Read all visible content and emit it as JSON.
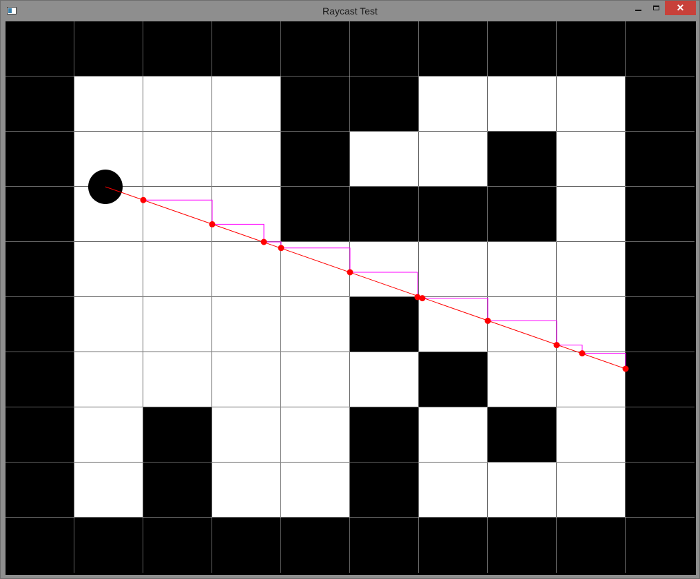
{
  "window": {
    "title": "Raycast Test",
    "minimize_icon": "minimize-icon",
    "maximize_icon": "maximize-icon",
    "close_icon": "close-icon",
    "close_glyph": "✕"
  },
  "grid": {
    "cols": 10,
    "rows": 10,
    "cells": [
      [
        1,
        1,
        1,
        1,
        1,
        1,
        1,
        1,
        1,
        1
      ],
      [
        1,
        0,
        0,
        0,
        1,
        1,
        0,
        0,
        0,
        1
      ],
      [
        1,
        0,
        0,
        0,
        1,
        0,
        0,
        1,
        0,
        1
      ],
      [
        1,
        0,
        0,
        0,
        1,
        1,
        1,
        1,
        0,
        1
      ],
      [
        1,
        0,
        0,
        0,
        0,
        0,
        0,
        0,
        0,
        1
      ],
      [
        1,
        0,
        0,
        0,
        0,
        1,
        0,
        0,
        0,
        1
      ],
      [
        1,
        0,
        0,
        0,
        0,
        0,
        1,
        0,
        0,
        1
      ],
      [
        1,
        0,
        1,
        0,
        0,
        1,
        0,
        1,
        0,
        1
      ],
      [
        1,
        0,
        1,
        0,
        0,
        1,
        0,
        0,
        0,
        1
      ],
      [
        1,
        1,
        1,
        1,
        1,
        1,
        1,
        1,
        1,
        1
      ]
    ],
    "wall_color": "#000000",
    "floor_color": "#ffffff"
  },
  "player": {
    "col": 1.45,
    "row": 3.0,
    "color": "#000000"
  },
  "ray": {
    "color": "#ff0000",
    "step_color": "#ff00ff",
    "hits": [
      [
        2.0,
        3.24
      ],
      [
        3.0,
        3.68
      ],
      [
        3.75,
        4.0
      ],
      [
        4.0,
        4.11
      ],
      [
        5.0,
        4.55
      ],
      [
        5.98,
        5.0
      ],
      [
        6.05,
        5.02
      ],
      [
        7.0,
        5.43
      ],
      [
        8.0,
        5.87
      ],
      [
        8.37,
        6.02
      ],
      [
        9.0,
        6.3
      ]
    ]
  }
}
